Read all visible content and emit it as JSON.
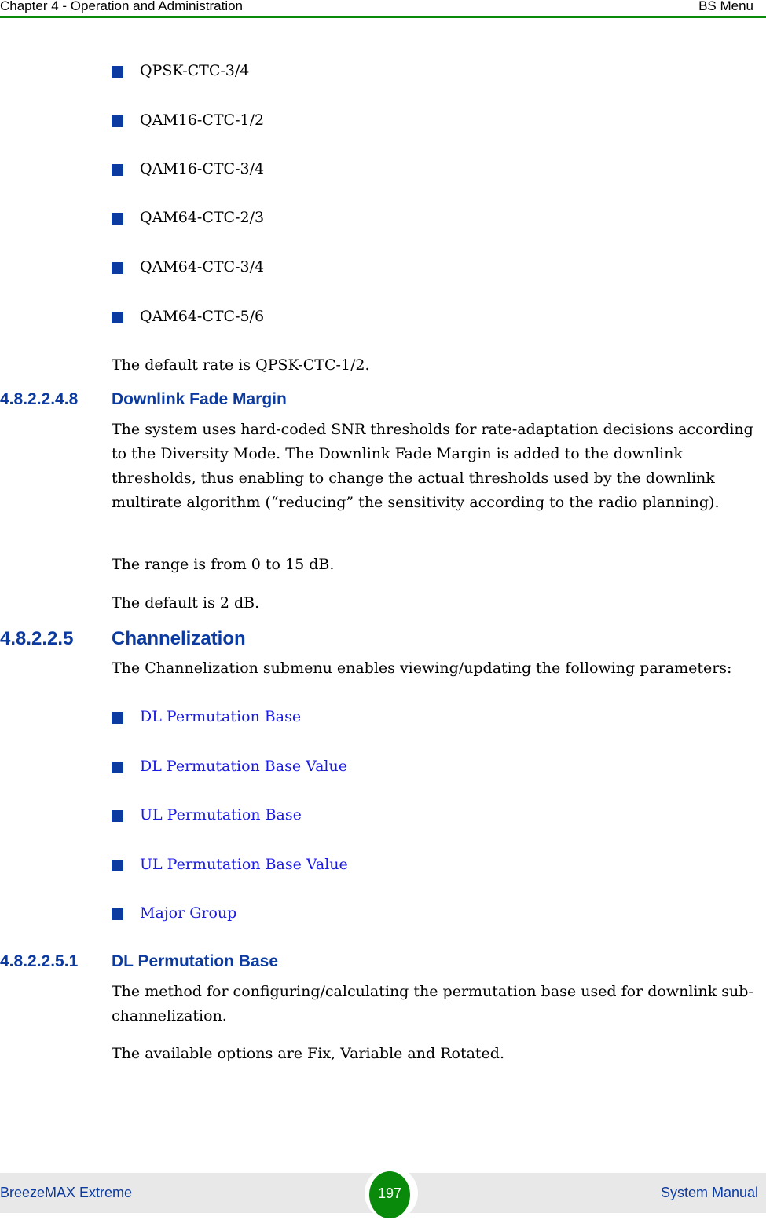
{
  "header": {
    "chapter": "Chapter 4 - Operation and Administration",
    "section": "BS Menu"
  },
  "rates_list": [
    "QPSK-CTC-3/4",
    "QAM16-CTC-1/2",
    "QAM16-CTC-3/4",
    "QAM64-CTC-2/3",
    "QAM64-CTC-3/4",
    "QAM64-CTC-5/6"
  ],
  "default_rate_text": "The default rate is QPSK-CTC-1/2.",
  "section_fade_margin": {
    "number": "4.8.2.2.4.8",
    "title": "Downlink Fade Margin",
    "paragraph": "The system uses hard-coded SNR thresholds for rate-adaptation decisions according to the Diversity Mode. The Downlink Fade Margin is added to the downlink thresholds, thus enabling to change the actual thresholds used by the downlink multirate algorithm (“reducing” the sensitivity according to the radio planning).",
    "range": "The range is from 0 to 15 dB.",
    "default": "The default is 2 dB."
  },
  "section_channelization": {
    "number": "4.8.2.2.5",
    "title": "Channelization",
    "paragraph": "The Channelization submenu enables viewing/updating the following parameters:",
    "links": [
      "DL Permutation Base",
      "DL Permutation Base Value",
      "UL Permutation Base",
      "UL Permutation Base Value",
      "Major Group"
    ]
  },
  "section_dl_perm": {
    "number": "4.8.2.2.5.1",
    "title": "DL Permutation Base",
    "paragraph": "The method for configuring/calculating the permutation base used for downlink sub-channelization.",
    "options": "The available options are Fix, Variable and Rotated."
  },
  "footer": {
    "product": "BreezeMAX Extreme",
    "page_number": "197",
    "doc_type": "System Manual"
  },
  "colors": {
    "header_rule": "#0a8a0a",
    "heading": "#0b3aa0",
    "link": "#1a1ae6",
    "bullet": "#0b3aa0",
    "footer_bg": "#e8e8e8",
    "page_badge": "#0a8a0a"
  }
}
